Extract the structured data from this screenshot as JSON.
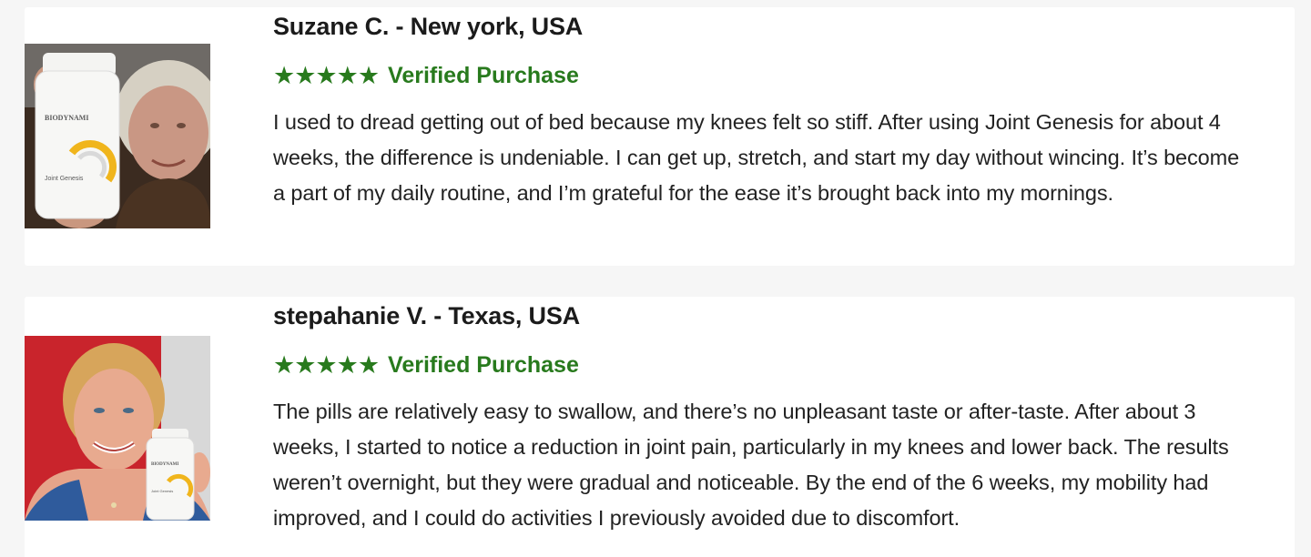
{
  "reviews": [
    {
      "name": "Suzane C. - New york, USA",
      "stars": "★★★★★",
      "badge": "Verified Purchase",
      "text": "I used to dread getting out of bed because my knees felt so stiff. After using Joint Genesis for about 4 weeks, the difference is undeniable. I can get up, stretch, and start my day without wincing. It’s become a part of my daily routine, and I’m grateful for the ease it’s brought back into my mornings.",
      "photo_bottle_label": "BIODYNAMI",
      "photo_product_label": "Joint Genesis"
    },
    {
      "name": "stepahanie V. - Texas, USA",
      "stars": "★★★★★",
      "badge": "Verified Purchase",
      "text": "The pills are relatively easy to swallow, and there’s no unpleasant taste or after-taste. After about 3 weeks, I started to notice a reduction in joint pain, particularly in my knees and lower back. The results weren’t overnight, but they were gradual and noticeable. By the end of the 6 weeks, my mobility had improved, and I could do activities I previously avoided due to discomfort.",
      "photo_bottle_label": "BIODYNAMI",
      "photo_product_label": "Joint Genesis"
    }
  ],
  "colors": {
    "accent_green": "#287a1d",
    "text": "#222222",
    "background": "#f6f6f6",
    "card": "#ffffff"
  }
}
